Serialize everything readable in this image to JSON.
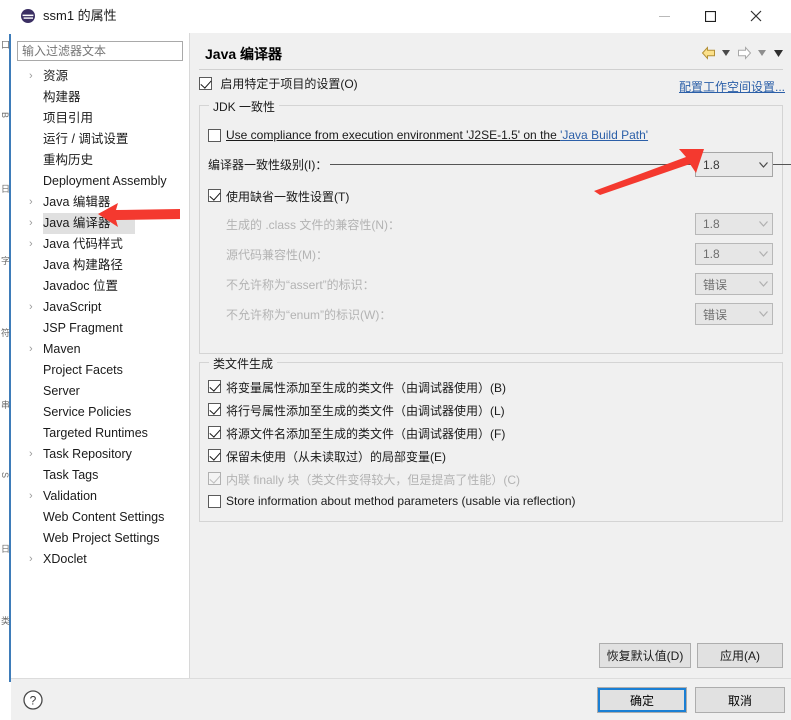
{
  "window": {
    "title": "ssm1 的属性",
    "app_icon": "eclipse-icon",
    "minimize": "minimize-icon",
    "maximize": "maximize-icon",
    "close": "close-icon"
  },
  "sidebar": {
    "filter_placeholder": "输入过滤器文本",
    "filter_value": "",
    "items": [
      {
        "label": "资源",
        "expandable": true,
        "selected": false
      },
      {
        "label": "构建器",
        "expandable": false,
        "selected": false
      },
      {
        "label": "项目引用",
        "expandable": false,
        "selected": false
      },
      {
        "label": "运行 / 调试设置",
        "expandable": false,
        "selected": false
      },
      {
        "label": "重构历史",
        "expandable": false,
        "selected": false
      },
      {
        "label": "Deployment Assembly",
        "expandable": false,
        "selected": false
      },
      {
        "label": "Java 编辑器",
        "expandable": true,
        "selected": false
      },
      {
        "label": "Java 编译器",
        "expandable": true,
        "selected": true
      },
      {
        "label": "Java 代码样式",
        "expandable": true,
        "selected": false
      },
      {
        "label": "Java 构建路径",
        "expandable": false,
        "selected": false
      },
      {
        "label": "Javadoc 位置",
        "expandable": false,
        "selected": false
      },
      {
        "label": "JavaScript",
        "expandable": true,
        "selected": false
      },
      {
        "label": "JSP Fragment",
        "expandable": false,
        "selected": false
      },
      {
        "label": "Maven",
        "expandable": true,
        "selected": false
      },
      {
        "label": "Project Facets",
        "expandable": false,
        "selected": false
      },
      {
        "label": "Server",
        "expandable": false,
        "selected": false
      },
      {
        "label": "Service Policies",
        "expandable": false,
        "selected": false
      },
      {
        "label": "Targeted Runtimes",
        "expandable": false,
        "selected": false
      },
      {
        "label": "Task Repository",
        "expandable": true,
        "selected": false
      },
      {
        "label": "Task Tags",
        "expandable": false,
        "selected": false
      },
      {
        "label": "Validation",
        "expandable": true,
        "selected": false
      },
      {
        "label": "Web Content Settings",
        "expandable": false,
        "selected": false
      },
      {
        "label": "Web Project Settings",
        "expandable": false,
        "selected": false
      },
      {
        "label": "XDoclet",
        "expandable": true,
        "selected": false
      }
    ]
  },
  "page": {
    "title": "Java 编译器",
    "nav": {
      "back_icon": "back-arrow-icon",
      "back_caret": "chevron-down-icon",
      "forward_icon": "forward-arrow-icon",
      "forward_caret": "chevron-down-icon",
      "menu_caret": "chevron-down-icon"
    },
    "enable_project_settings": {
      "label": "启用特定于项目的设置(O)",
      "checked": true
    },
    "workspace_link": "配置工作空间设置..."
  },
  "jdk_group": {
    "title": "JDK 一致性",
    "use_compliance": {
      "checked": false,
      "text_before": "Use compliance from execution environment 'J2SE-1.5' on the ",
      "link_text": "'Java Build Path'"
    },
    "compliance_level": {
      "label": "编译器一致性级别(I)：",
      "value": "1.8",
      "enabled": true
    },
    "use_default_compliance": {
      "label": "使用缺省一致性设置(T)",
      "checked": true
    },
    "rows": [
      {
        "label": "生成的 .class 文件的兼容性(N)：",
        "value": "1.8",
        "disabled": true
      },
      {
        "label": "源代码兼容性(M)：",
        "value": "1.8",
        "disabled": true
      },
      {
        "label": "不允许称为“assert”的标识：",
        "value": "错误",
        "disabled": true
      },
      {
        "label": "不允许称为“enum”的标识(W)：",
        "value": "错误",
        "disabled": true
      }
    ]
  },
  "classfile_group": {
    "title": "类文件生成",
    "options": [
      {
        "label": "将变量属性添加至生成的类文件（由调试器使用）(B)",
        "checked": true,
        "disabled": false
      },
      {
        "label": "将行号属性添加至生成的类文件（由调试器使用）(L)",
        "checked": true,
        "disabled": false
      },
      {
        "label": "将源文件名添加至生成的类文件（由调试器使用）(F)",
        "checked": true,
        "disabled": false
      },
      {
        "label": "保留未使用（从未读取过）的局部变量(E)",
        "checked": true,
        "disabled": false
      },
      {
        "label": "内联 finally 块（类文件变得较大，但是提高了性能）(C)",
        "checked": true,
        "disabled": true
      },
      {
        "label": "Store information about method parameters (usable via reflection)",
        "checked": false,
        "disabled": false
      }
    ]
  },
  "buttons": {
    "restore_defaults": "恢复默认值(D)",
    "apply": "应用(A)",
    "ok": "确定",
    "cancel": "取消",
    "help_icon": "help-icon"
  },
  "annotations": {
    "arrow_color": "#f4392f",
    "arrow_to_combo": "red-arrow-pointing-to-compliance-dropdown",
    "arrow_to_tree": "red-arrow-pointing-to-java-compiler-item"
  },
  "background_bleed": {
    "lines": [
      "口",
      "B",
      "日",
      "字",
      "符",
      "串",
      "S",
      "日",
      "类"
    ]
  }
}
